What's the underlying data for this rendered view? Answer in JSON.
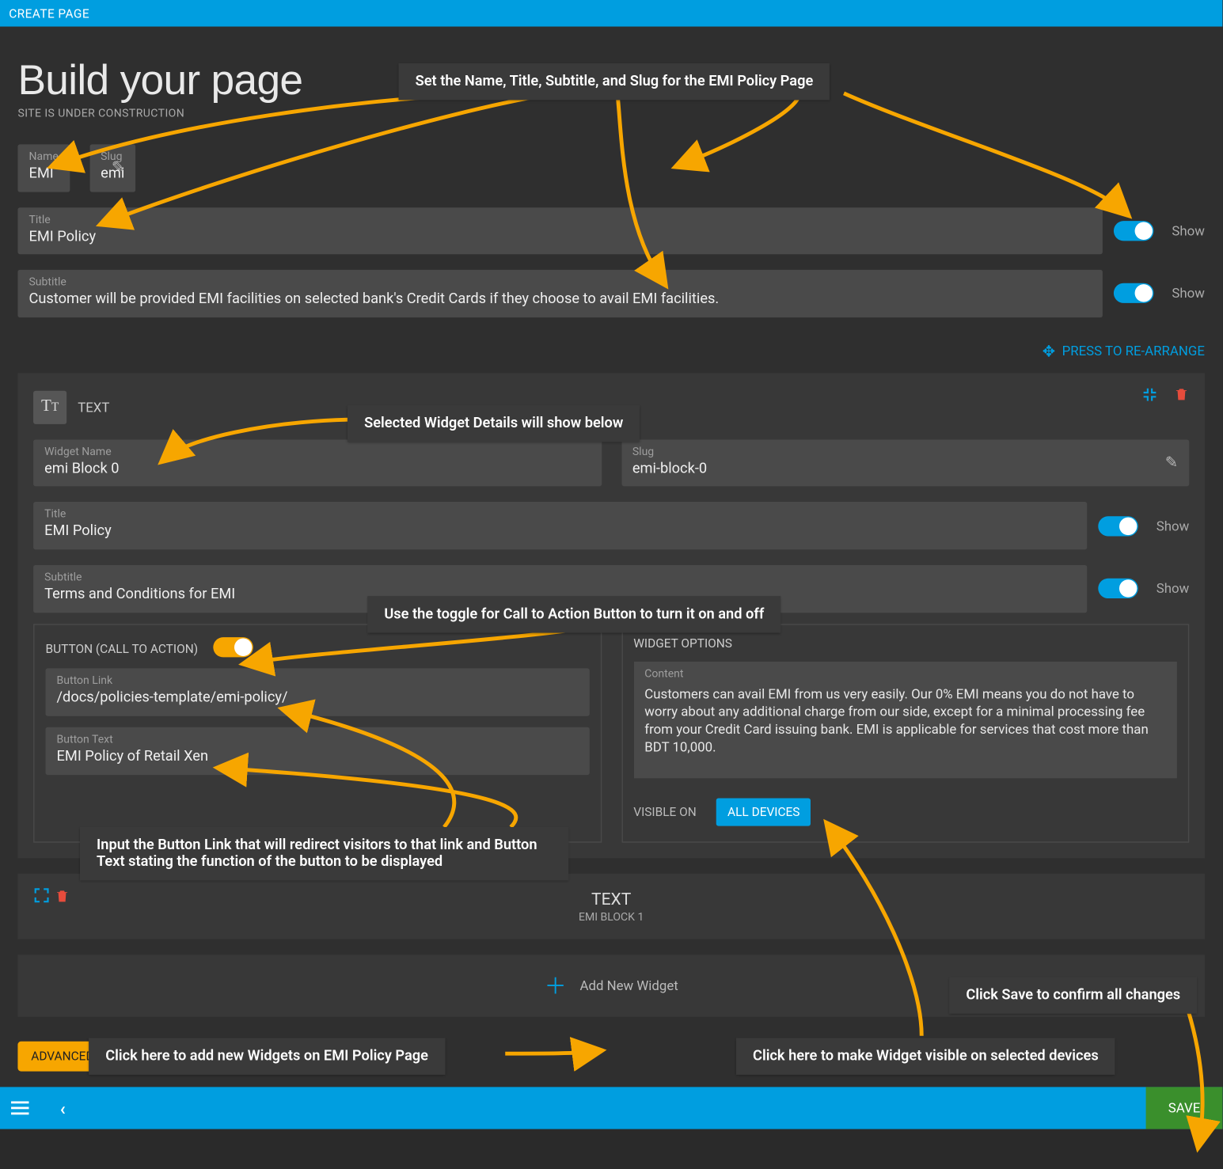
{
  "topbar": {
    "title": "CREATE PAGE"
  },
  "header": {
    "title": "Build your page",
    "subtitle": "SITE IS UNDER CONSTRUCTION"
  },
  "fields": {
    "name": {
      "label": "Name",
      "value": "EMI"
    },
    "slug": {
      "label": "Slug",
      "value": "emi"
    },
    "title": {
      "label": "Title",
      "value": "EMI Policy"
    },
    "subtitle": {
      "label": "Subtitle",
      "value": "Customer will be provided EMI facilities on selected bank's Credit Cards if they choose to avail EMI facilities."
    },
    "show_label": "Show"
  },
  "rearrange": "PRESS TO RE-ARRANGE",
  "widget": {
    "type_label": "TEXT",
    "name": {
      "label": "Widget Name",
      "value": "emi Block 0"
    },
    "slug": {
      "label": "Slug",
      "value": "emi-block-0"
    },
    "title": {
      "label": "Title",
      "value": "EMI Policy"
    },
    "subtitle": {
      "label": "Subtitle",
      "value": "Terms and Conditions for EMI"
    },
    "show_label": "Show",
    "cta": {
      "heading": "BUTTON (CALL TO ACTION)",
      "link": {
        "label": "Button Link",
        "value": "/docs/policies-template/emi-policy/"
      },
      "text": {
        "label": "Button Text",
        "value": "EMI Policy of Retail Xen"
      }
    },
    "options": {
      "heading": "WIDGET OPTIONS",
      "content_label": "Content",
      "content": "Customers can avail EMI from us very easily.  Our 0% EMI means you do not have to worry about any additional charge from our side, except for a minimal processing fee from your Credit Card issuing bank. EMI is applicable for services that cost more than BDT 10,000.",
      "visible_label": "VISIBLE ON",
      "visible_chip": "ALL DEVICES"
    }
  },
  "widget2": {
    "title": "TEXT",
    "sub": "EMI BLOCK 1"
  },
  "add_new": "Add New Widget",
  "advanced": "ADVANCED OPTIONS",
  "save": "SAVE",
  "callouts": {
    "c1": "Set the Name, Title, Subtitle, and Slug for the EMI Policy Page",
    "c2": "Selected Widget Details will show below",
    "c3": "Use the toggle for Call to Action Button to turn it on and off",
    "c4": "Input the Button Link that will redirect visitors to that link and Button Text stating the function of the button to be displayed",
    "c5": "Click here to add new Widgets on EMI Policy Page",
    "c6": "Click here to make Widget visible on selected devices",
    "c7": "Click Save to confirm all changes"
  }
}
